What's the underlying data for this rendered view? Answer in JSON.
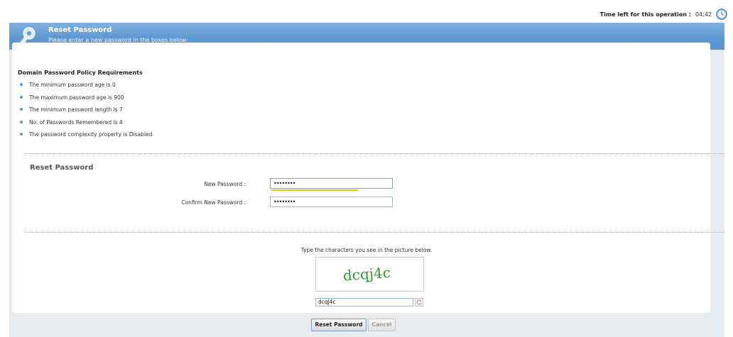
{
  "timer": {
    "label": "Time left for this operation :",
    "value": "04:42",
    "icon": "clock-icon"
  },
  "header": {
    "title": "Reset Password",
    "subtitle": "Please enter a new password in the boxes below:",
    "icon": "key-icon",
    "color": "#5f99d2"
  },
  "policy": {
    "title": "Domain Password Policy Requirements",
    "items": [
      "The minimum password age is 0",
      "The maximum password age is 900",
      "The minimum password length is 7",
      "No. of Passwords Remembered is 4",
      "The password complexity property is Disabled"
    ]
  },
  "reset": {
    "section_title": "Reset Password",
    "new_password_label": "New Password :",
    "new_password_value": "••••••••",
    "confirm_password_label": "Confirm New Password :",
    "confirm_password_value": "••••••••"
  },
  "captcha": {
    "prompt": "Type the characters you see in the picture below.",
    "image_text": "dcqj4c",
    "input_value": "dcqj4c",
    "refresh_icon": "refresh-icon"
  },
  "buttons": {
    "reset": "Reset Password",
    "cancel": "Cancel"
  }
}
